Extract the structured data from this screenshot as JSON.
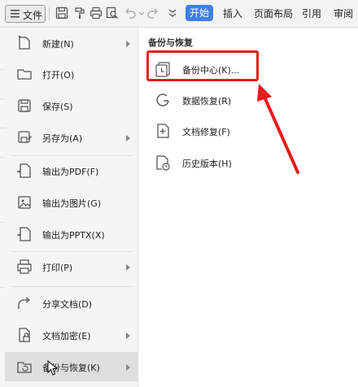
{
  "toolbar": {
    "file_label": "文件",
    "tabs": [
      "开始",
      "插入",
      "页面布局",
      "引用",
      "审阅"
    ],
    "active_tab_index": 0,
    "icons": [
      "save-icon",
      "format-painter-icon",
      "print-icon",
      "print-preview-icon",
      "undo-icon",
      "redo-icon",
      "customize-dropdown-icon"
    ]
  },
  "menu": {
    "items": [
      {
        "label": "新建(N)",
        "icon": "new-document-icon",
        "has_submenu": true
      },
      {
        "label": "打开(O)",
        "icon": "open-folder-icon",
        "has_submenu": false
      },
      {
        "label": "保存(S)",
        "icon": "save-icon",
        "has_submenu": false
      },
      {
        "label": "另存为(A)",
        "icon": "save-as-icon",
        "has_submenu": true
      },
      {
        "label": "输出为PDF(F)",
        "icon": "pdf-icon",
        "has_submenu": false
      },
      {
        "label": "输出为图片(G)",
        "icon": "image-icon",
        "has_submenu": false
      },
      {
        "label": "输出为PPTX(X)",
        "icon": "pptx-icon",
        "has_submenu": false
      },
      {
        "label": "打印(P)",
        "icon": "print-icon",
        "has_submenu": true
      },
      {
        "label": "分享文档(D)",
        "icon": "share-icon",
        "has_submenu": false
      },
      {
        "label": "文档加密(E)",
        "icon": "encrypt-icon",
        "has_submenu": true
      },
      {
        "label": "备份与恢复(K)",
        "icon": "backup-restore-icon",
        "has_submenu": true
      }
    ],
    "selected_index": 10
  },
  "submenu": {
    "title": "备份与恢复",
    "items": [
      {
        "label": "备份中心(K)...",
        "icon": "backup-center-icon"
      },
      {
        "label": "数据恢复(R)",
        "icon": "data-recovery-icon"
      },
      {
        "label": "文档修复(F)",
        "icon": "document-repair-icon"
      },
      {
        "label": "历史版本(H)",
        "icon": "history-version-icon"
      }
    ],
    "highlighted_index": 0
  },
  "colors": {
    "accent": "#3f7fe6",
    "annotation": "#e81b1b",
    "menu_bg": "#f5f5f5",
    "selected_bg": "#dedede"
  }
}
